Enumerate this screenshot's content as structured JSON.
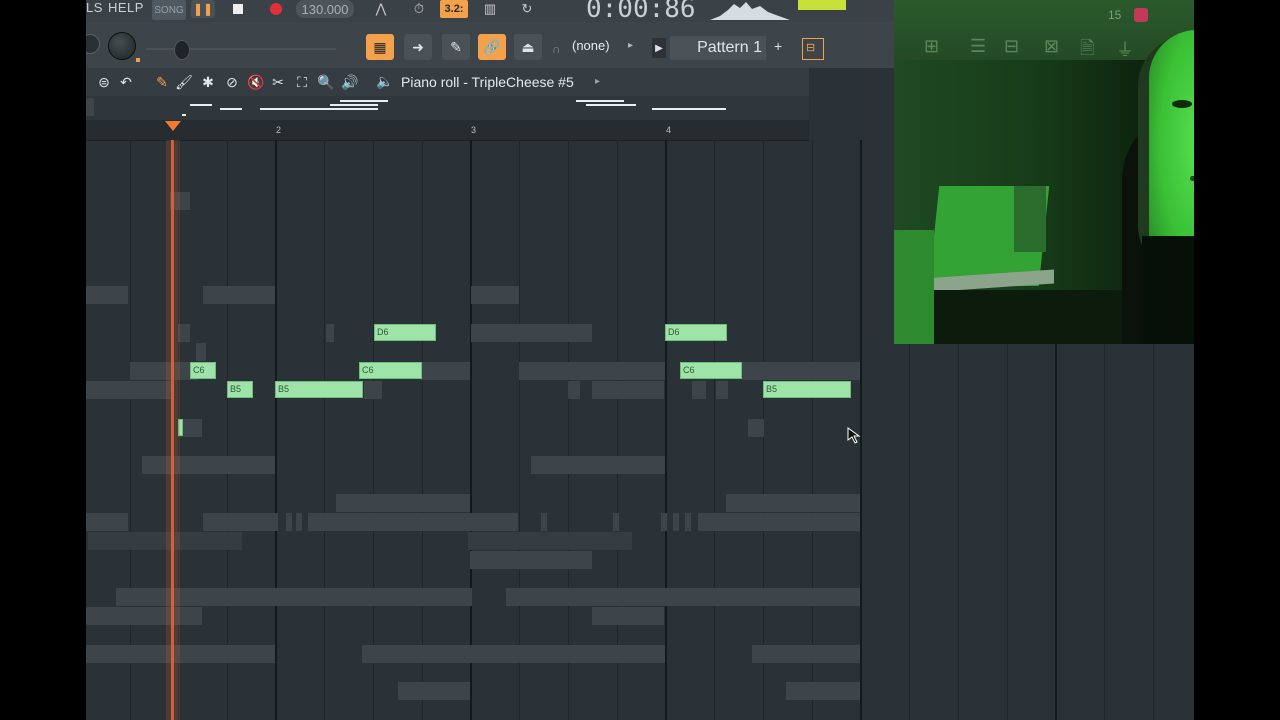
{
  "menu": {
    "partial_tools": "LS",
    "help": "HELP"
  },
  "transport": {
    "mode": "SONG",
    "tempo": "130.000",
    "time_display": "0:00:86",
    "pattern_counter": "3.2:"
  },
  "toolbar": {
    "channel_select": "(none)",
    "pattern": "Pattern 1",
    "add_label": "+"
  },
  "piano_roll": {
    "title": "Piano roll - TripleCheese #5",
    "ruler_marks": [
      "2",
      "3",
      "4"
    ],
    "notes": [
      {
        "label": "D6"
      },
      {
        "label": "C6"
      },
      {
        "label": "B5"
      },
      {
        "label": "B5"
      },
      {
        "label": "C6"
      },
      {
        "label": "D6"
      },
      {
        "label": "C6"
      },
      {
        "label": "B5"
      }
    ]
  },
  "webcam": {
    "counter": "15"
  },
  "colors": {
    "accent": "#f3a14a",
    "note_fill": "#9ee3a8",
    "playhead": "#e5692f",
    "background": "#2b3237"
  }
}
